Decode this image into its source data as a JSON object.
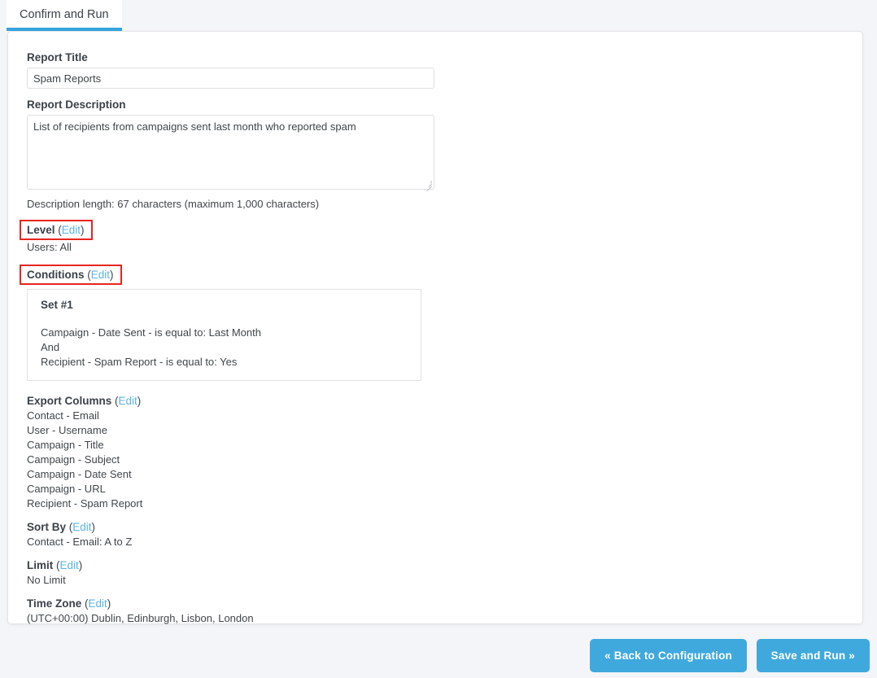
{
  "tab": {
    "label": "Confirm and Run",
    "accent_color": "#35a4dc"
  },
  "form": {
    "title_label": "Report Title",
    "title_value": "Spam Reports",
    "title_placeholder": "Report Title",
    "description_label": "Report Description",
    "description_value": "List of recipients from campaigns sent last month who reported spam",
    "description_placeholder": "Report Description",
    "description_helper": "Description length: 67 characters (maximum 1,000 characters)"
  },
  "edit_label": "Edit",
  "sections": {
    "level": {
      "title": "Level",
      "value": "Users: All",
      "highlighted": true,
      "highlight_color": "#e8251f"
    },
    "conditions": {
      "title": "Conditions",
      "highlighted": true,
      "highlight_color": "#e8251f",
      "set_title": "Set #1",
      "lines": [
        "Campaign - Date Sent - is equal to: Last Month",
        "And",
        "Recipient - Spam Report - is equal to: Yes"
      ]
    },
    "export_columns": {
      "title": "Export Columns",
      "items": [
        "Contact - Email",
        "User - Username",
        "Campaign - Title",
        "Campaign - Subject",
        "Campaign - Date Sent",
        "Campaign - URL",
        "Recipient - Spam Report"
      ]
    },
    "sort_by": {
      "title": "Sort By",
      "value": "Contact - Email: A to Z"
    },
    "limit": {
      "title": "Limit",
      "value": "No Limit"
    },
    "time_zone": {
      "title": "Time Zone",
      "value": "(UTC+00:00) Dublin, Edinburgh, Lisbon, London"
    }
  },
  "footer": {
    "back_label": "« Back to Configuration",
    "run_label": "Save and Run »",
    "button_color": "#3fa9dd"
  }
}
